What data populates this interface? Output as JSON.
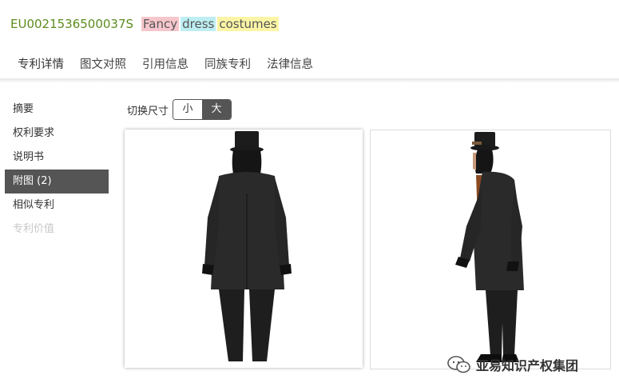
{
  "header": {
    "patent_id": "EU0021536500037S",
    "keywords": [
      "Fancy",
      "dress",
      "costumes"
    ]
  },
  "tabs": [
    {
      "label": "专利详情",
      "active": true
    },
    {
      "label": "图文对照",
      "active": false
    },
    {
      "label": "引用信息",
      "active": false
    },
    {
      "label": "同族专利",
      "active": false
    },
    {
      "label": "法律信息",
      "active": false
    }
  ],
  "sidebar": {
    "items": [
      {
        "label": "摘要"
      },
      {
        "label": "权利要求"
      },
      {
        "label": "说明书"
      },
      {
        "label": "附图 (2)",
        "active": true
      },
      {
        "label": "相似专利"
      },
      {
        "label": "专利价值",
        "disabled": true
      }
    ]
  },
  "size_switch": {
    "label": "切换尺寸",
    "small": "小",
    "large": "大",
    "selected": "大"
  },
  "figures": [
    {
      "icon": "costume-back-view-image"
    },
    {
      "icon": "costume-side-view-image"
    }
  ],
  "watermark": {
    "text": "亚易知识产权集团",
    "icon": "wechat-icon"
  },
  "colors": {
    "patent_id": "#5b8c1e",
    "active_tab_border": "#555555",
    "active_item_bg": "#555555",
    "kw_pink": "#f7c6cc",
    "kw_cyan": "#bdeef2",
    "kw_yellow": "#fbf5a5"
  }
}
